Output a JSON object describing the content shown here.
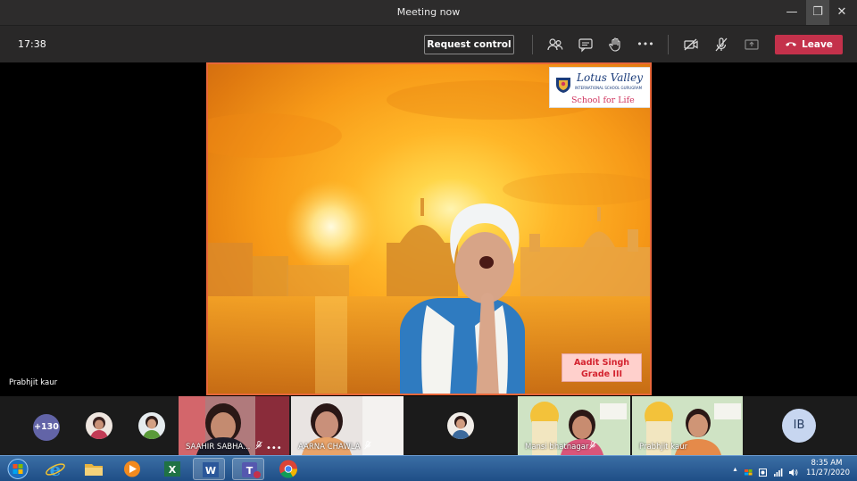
{
  "window": {
    "title": "Meeting now",
    "minimize_glyph": "—",
    "maximize_glyph": "❐",
    "close_glyph": "✕"
  },
  "toolbar": {
    "timer": "17:38",
    "request_control_label": "Request control",
    "leave_label": "Leave",
    "icons": [
      "participants-icon",
      "chat-icon",
      "raise-hand-icon",
      "more-options-icon",
      "camera-off-icon",
      "mic-off-icon",
      "share-tray-icon"
    ],
    "more_glyph": "•••",
    "leave_color": "#c4314b"
  },
  "stage": {
    "presenter_name": "Prabhjit kaur",
    "logo": {
      "brand": "Lotus Valley",
      "sub": "INTERNATIONAL SCHOOL GURUGRAM",
      "tagline": "School for Life"
    },
    "name_plate": {
      "line1": "Aadit Singh",
      "line2": "Grade III"
    },
    "frame_color": "#e8673a"
  },
  "participants": {
    "overflow_count": "+130",
    "tiles": [
      {
        "label": "SAAHIR SABHA...",
        "more": "•••"
      },
      {
        "label": "AARNA CHAWLA"
      },
      {
        "label": "Mansi bhatnagar"
      },
      {
        "label": "Prabhjit kaur"
      }
    ],
    "initials": "IB",
    "badge_color": "#6264a7"
  },
  "taskbar": {
    "apps": [
      "windows-start-icon",
      "internet-explorer-icon",
      "file-explorer-icon",
      "media-player-icon",
      "excel-icon",
      "word-icon",
      "teams-icon",
      "chrome-icon"
    ],
    "clock_time": "8:35 AM",
    "clock_date": "11/27/2020"
  }
}
